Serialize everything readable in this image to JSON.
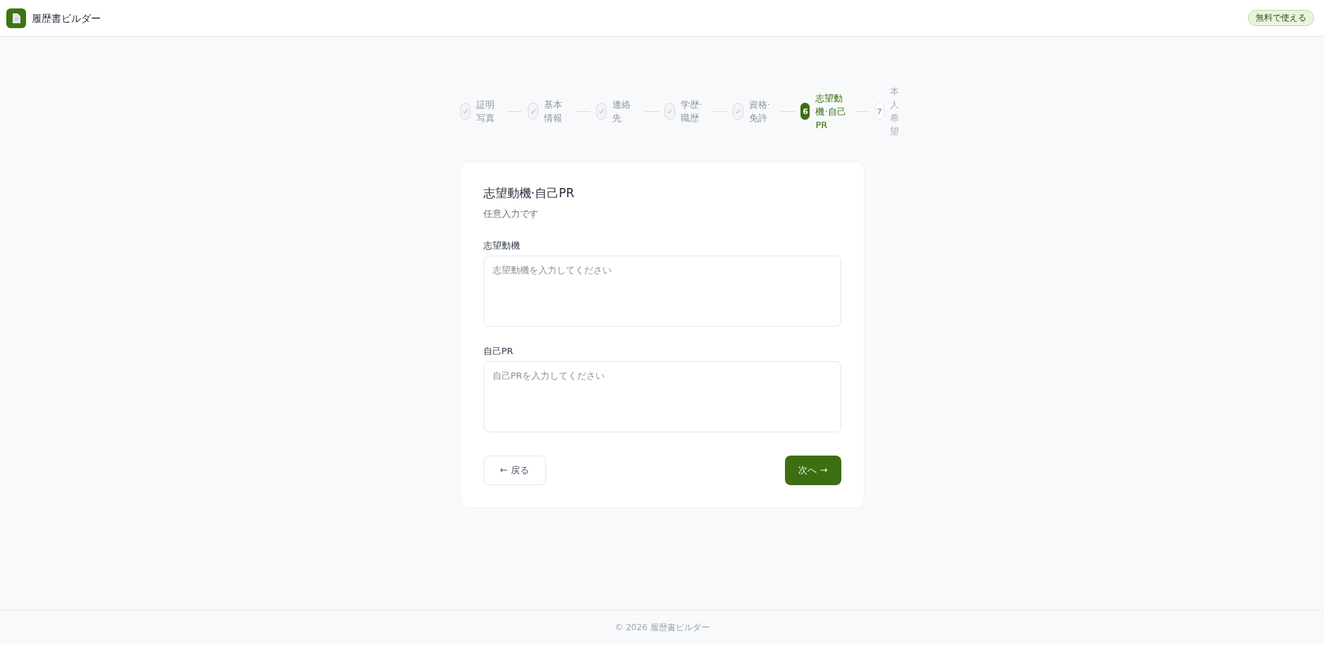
{
  "header": {
    "app_name": "履歴書ビルダー",
    "badge": "無料で使える"
  },
  "steps": [
    {
      "label": "証明写真",
      "done": true,
      "selected": false
    },
    {
      "label": "基本情報",
      "done": true,
      "selected": false
    },
    {
      "label": "連絡先",
      "done": true,
      "selected": false
    },
    {
      "label": "学歴·職歴",
      "done": true,
      "selected": false
    },
    {
      "label": "資格·免許",
      "done": true,
      "selected": false
    },
    {
      "number": "6",
      "label": "志望動機·自己PR",
      "done": false,
      "selected": true
    },
    {
      "number": "7",
      "label": "本人希望",
      "done": false,
      "selected": false
    }
  ],
  "form": {
    "title": "志望動機·自己PR",
    "subtitle": "任意入力です",
    "fields": [
      {
        "label": "志望動機",
        "placeholder": "志望動機を入力してください"
      },
      {
        "label": "自己PR",
        "placeholder": "自己PRを入力してください"
      }
    ],
    "back_button": "← 戻る",
    "next_button": "次へ →"
  },
  "footer": {
    "copyright": "© 2026 履歴書ビルダー"
  }
}
